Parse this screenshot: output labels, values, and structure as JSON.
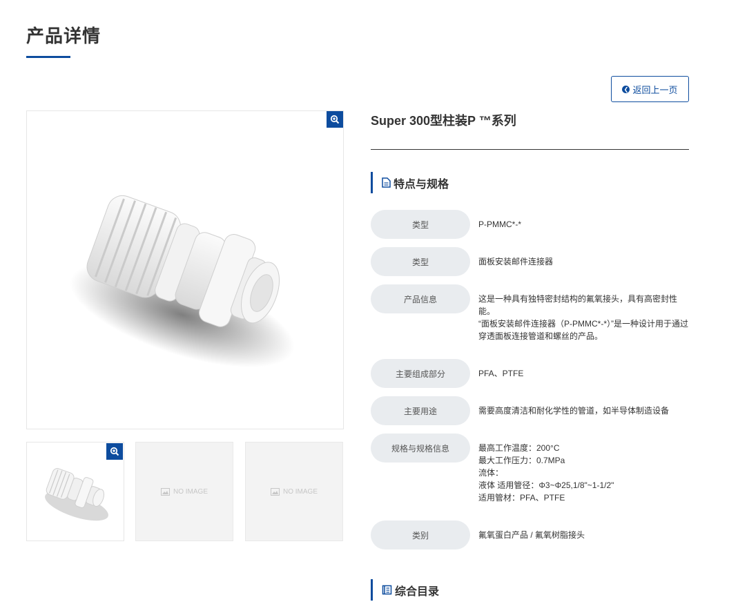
{
  "page": {
    "title": "产品详情"
  },
  "back_button": {
    "label": "返回上一页",
    "icon": "arrow-left-circle-icon"
  },
  "gallery": {
    "zoom_icon": "zoom-in-icon",
    "no_image_label": "NO IMAGE",
    "accent": "#0d4c9e"
  },
  "product": {
    "title": "Super 300型柱装P ™系列"
  },
  "features_section": {
    "title": "特点与规格",
    "icon": "document-icon"
  },
  "specs": [
    {
      "label": "类型",
      "value": [
        "P-PMMC*-*"
      ]
    },
    {
      "label": "类型",
      "value": [
        "面板安装邮件连接器"
      ]
    },
    {
      "label": "产品信息",
      "value": [
        "这是一种具有独特密封结构的氟氧接头，具有高密封性",
        "能。",
        "“面板安装邮件连接器（P-PMMC*-*）”是一种设计用于通过",
        "穿透面板连接管道和螺丝的产品。"
      ]
    },
    {
      "label": "主要组成部分",
      "value": [
        "PFA、PTFE"
      ]
    },
    {
      "label": "主要用途",
      "value": [
        "需要高度清洁和耐化学性的管道，如半导体制造设备"
      ]
    },
    {
      "label": "规格与规格信息",
      "value": [
        "最高工作温度：200°C",
        "最大工作压力：0.7MPa",
        "流体：",
        "液体 适用管径：Φ3~Φ25,1/8\"~1-1/2\"",
        "适用管材：PFA、PTFE"
      ]
    },
    {
      "label": "类别",
      "value": [
        "氟氧蛋白产品 / 氟氧树脂接头"
      ]
    }
  ],
  "catalog_section": {
    "title": "综合目录",
    "icon": "book-icon"
  }
}
